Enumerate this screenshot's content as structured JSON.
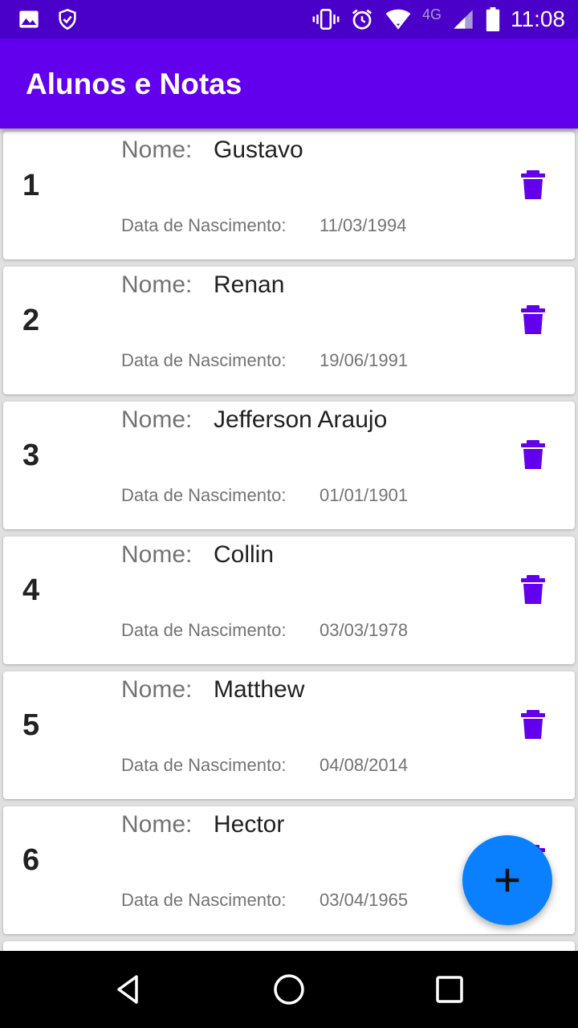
{
  "status_bar": {
    "time": "11:08",
    "network": "4G",
    "icons": [
      "image-icon",
      "shield-check-icon",
      "vibrate-icon",
      "alarm-icon",
      "wifi-icon",
      "signal-icon",
      "battery-icon"
    ]
  },
  "app_bar": {
    "title": "Alunos e Notas"
  },
  "labels": {
    "name": "Nome:",
    "birth": "Data de Nascimento:"
  },
  "students": [
    {
      "number": "1",
      "name": "Gustavo",
      "birth": "11/03/1994"
    },
    {
      "number": "2",
      "name": "Renan",
      "birth": "19/06/1991"
    },
    {
      "number": "3",
      "name": "Jefferson Araujo",
      "birth": "01/01/1901"
    },
    {
      "number": "4",
      "name": "Collin",
      "birth": "03/03/1978"
    },
    {
      "number": "5",
      "name": "Matthew",
      "birth": "04/08/2014"
    },
    {
      "number": "6",
      "name": "Hector",
      "birth": "03/04/1965"
    }
  ],
  "fab": {
    "icon": "plus-icon"
  },
  "colors": {
    "primary": "#6200ee",
    "status_bar": "#4a00c9",
    "fab": "#0a80ff",
    "delete_icon": "#6200ee"
  },
  "nav_bar": {
    "icons": [
      "back-icon",
      "home-icon",
      "recents-icon"
    ]
  }
}
